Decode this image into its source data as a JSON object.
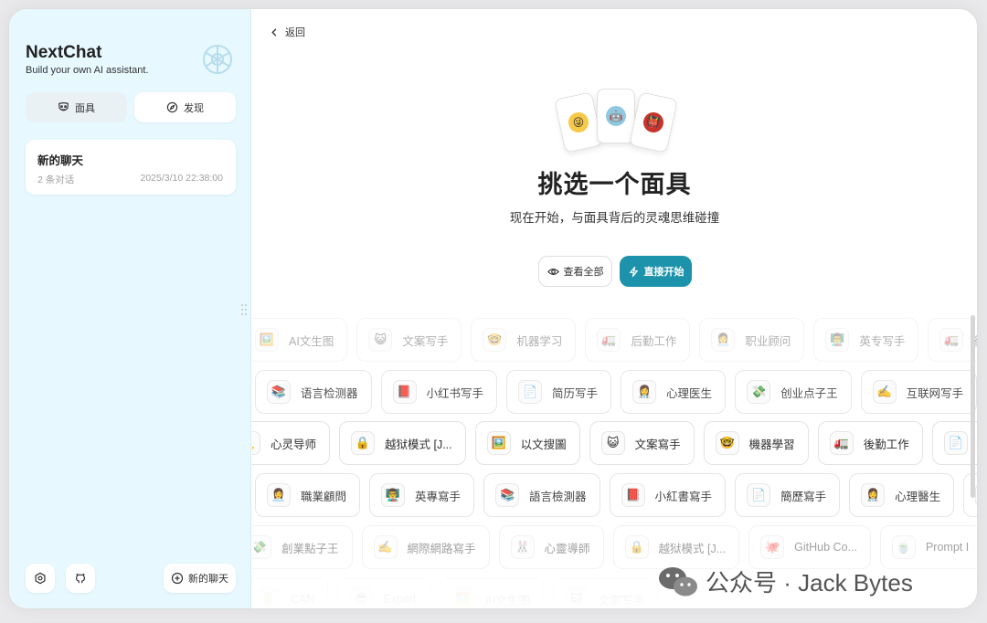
{
  "sidebar": {
    "title": "NextChat",
    "subtitle": "Build your own AI assistant.",
    "masks_button": "面具",
    "discover_button": "发现",
    "chats": [
      {
        "title": "新的聊天",
        "count": "2 条对话",
        "time": "2025/3/10 22:38:00"
      }
    ],
    "new_chat_button": "新的聊天"
  },
  "main": {
    "back_label": "返回",
    "title": "挑选一个面具",
    "subtitle": "现在开始，与面具背后的灵魂思维碰撞",
    "view_all_button": "查看全部",
    "start_button": "直接开始",
    "accent_color": "#1d93ab",
    "rows": [
      [
        {
          "icon": "picture",
          "label": "AI文生图"
        },
        {
          "icon": "cat-face",
          "label": "文案写手"
        },
        {
          "icon": "nerd-face",
          "label": "机器学习"
        },
        {
          "icon": "truck",
          "label": "后勤工作"
        },
        {
          "icon": "person",
          "label": "职业顾问"
        },
        {
          "icon": "teacher",
          "label": "英专写手"
        },
        {
          "icon": "truck",
          "label": "後勤工作"
        }
      ],
      [
        {
          "icon": "books",
          "label": "语言检测器"
        },
        {
          "icon": "red-book",
          "label": "小红书写手"
        },
        {
          "icon": "page",
          "label": "简历写手"
        },
        {
          "icon": "doctor",
          "label": "心理医生"
        },
        {
          "icon": "money",
          "label": "创业点子王"
        },
        {
          "icon": "writing-hand",
          "label": "互联网写手"
        }
      ],
      [
        {
          "icon": "mentor",
          "label": "心灵导师"
        },
        {
          "icon": "lock",
          "label": "越狱模式 [J..."
        },
        {
          "icon": "picture",
          "label": "以文搜圖"
        },
        {
          "icon": "cat-face",
          "label": "文案寫手"
        },
        {
          "icon": "nerd-face",
          "label": "機器學習"
        },
        {
          "icon": "truck",
          "label": "後勤工作"
        },
        {
          "icon": "page",
          "label": "簡"
        }
      ],
      [
        {
          "icon": "person",
          "label": "職業顧問"
        },
        {
          "icon": "teacher",
          "label": "英專寫手"
        },
        {
          "icon": "books",
          "label": "語言檢測器"
        },
        {
          "icon": "red-book",
          "label": "小紅書寫手"
        },
        {
          "icon": "page",
          "label": "簡歷寫手"
        },
        {
          "icon": "doctor",
          "label": "心理醫生"
        },
        {
          "icon": "books",
          "label": ""
        }
      ],
      [
        {
          "icon": "money",
          "label": "創業點子王"
        },
        {
          "icon": "writing-hand",
          "label": "網際網路寫手"
        },
        {
          "icon": "bunny",
          "label": "心靈導師"
        },
        {
          "icon": "lock",
          "label": "越狱模式 [J..."
        },
        {
          "icon": "octopus",
          "label": "GitHub Co..."
        },
        {
          "icon": "teapot",
          "label": "Prompt I"
        }
      ],
      [
        {
          "icon": "can",
          "label": "CAN"
        },
        {
          "icon": "expert",
          "label": "Expert"
        },
        {
          "icon": "picture",
          "label": "AI文生图"
        },
        {
          "icon": "cat-face",
          "label": "文案写手"
        }
      ]
    ]
  },
  "watermark": {
    "text": "公众号 · Jack Bytes"
  }
}
